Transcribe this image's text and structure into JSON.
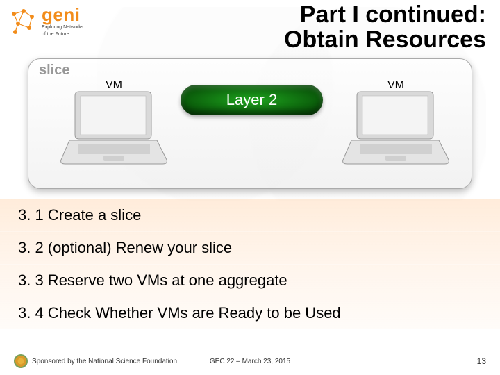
{
  "header": {
    "title_line1": "Part I continued:",
    "title_line2": "Obtain Resources",
    "logo_word": "geni",
    "logo_tag1": "Exploring Networks",
    "logo_tag2": "of the Future"
  },
  "diagram": {
    "slice_label": "slice",
    "vm_left_label": "VM",
    "vm_right_label": "VM",
    "link_label": "Layer 2"
  },
  "steps": [
    "3. 1 Create a slice",
    "3. 2 (optional) Renew your slice",
    "3. 3 Reserve two VMs at one aggregate",
    "3. 4 Check Whether VMs are Ready to be Used"
  ],
  "footer": {
    "left": "Sponsored by the National Science Foundation",
    "center": "GEC 22 – March 23, 2015",
    "page": "13"
  }
}
